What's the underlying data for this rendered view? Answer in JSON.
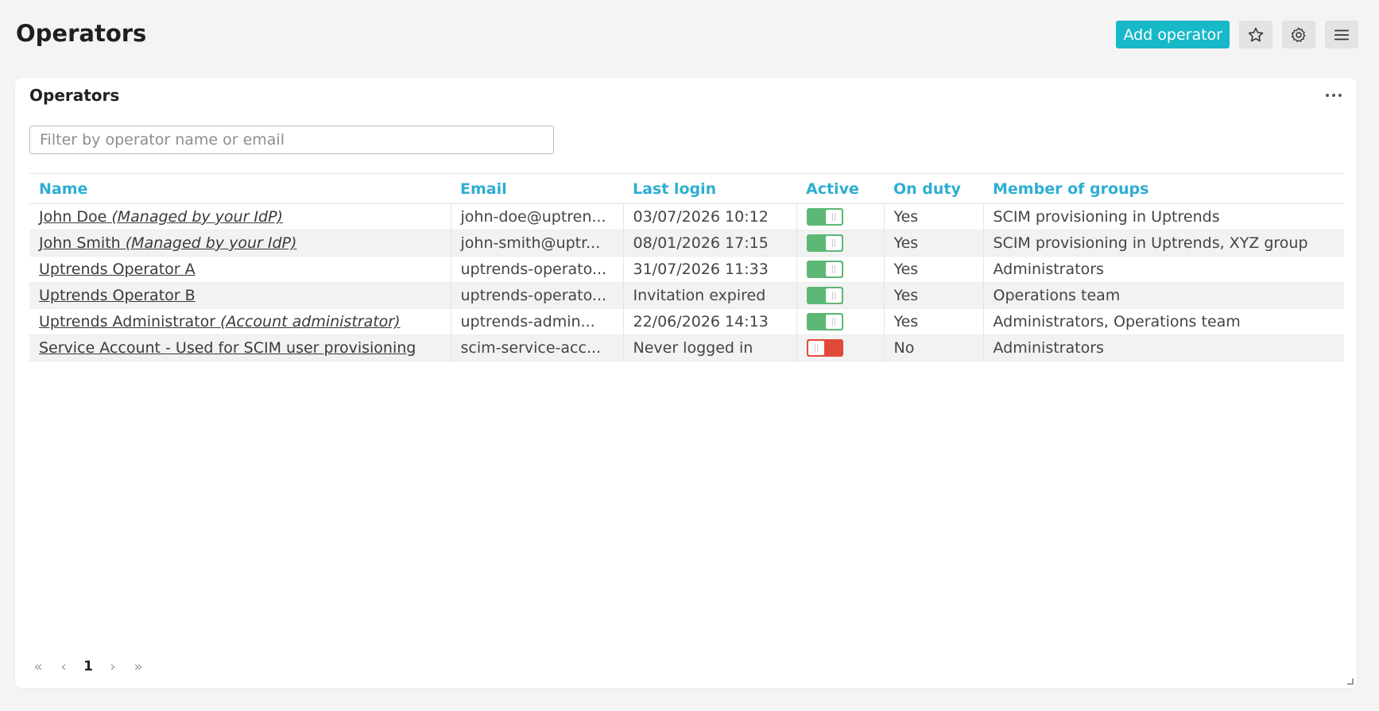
{
  "header": {
    "title": "Operators",
    "add_label": "Add operator"
  },
  "icons": {
    "favorite": "star-outline-icon",
    "settings": "gear-icon",
    "menu": "hamburger-menu-icon",
    "card_menu": "ellipsis-icon"
  },
  "colors": {
    "accent": "#17b8c8",
    "header_text": "#2eaed2",
    "toggle_on": "#5cb874",
    "toggle_off": "#e04a3b"
  },
  "card": {
    "title": "Operators",
    "filter_placeholder": "Filter by operator name or email"
  },
  "table": {
    "columns": [
      "Name",
      "Email",
      "Last login",
      "Active",
      "On duty",
      "Member of groups"
    ],
    "rows": [
      {
        "name": "John Doe",
        "name_note": "(Managed by your IdP)",
        "email": "john-doe@uptren...",
        "last_login": "03/07/2026 10:12",
        "active": true,
        "on_duty": "Yes",
        "groups": "SCIM provisioning in Uptrends"
      },
      {
        "name": "John Smith",
        "name_note": "(Managed by your IdP)",
        "email": "john-smith@uptr...",
        "last_login": "08/01/2026 17:15",
        "active": true,
        "on_duty": "Yes",
        "groups": "SCIM provisioning in Uptrends, XYZ group"
      },
      {
        "name": "Uptrends Operator A",
        "name_note": "",
        "email": "uptrends-operato...",
        "last_login": "31/07/2026 11:33",
        "active": true,
        "on_duty": "Yes",
        "groups": "Administrators"
      },
      {
        "name": "Uptrends Operator B",
        "name_note": "",
        "email": "uptrends-operato...",
        "last_login": "Invitation expired",
        "active": true,
        "on_duty": "Yes",
        "groups": "Operations team"
      },
      {
        "name": "Uptrends Administrator",
        "name_note": "(Account administrator)",
        "email": "uptrends-admin...",
        "last_login": "22/06/2026 14:13",
        "active": true,
        "on_duty": "Yes",
        "groups": "Administrators, Operations team"
      },
      {
        "name": "Service Account - Used for SCIM user provisioning",
        "name_note": "",
        "email": "scim-service-acc...",
        "last_login": "Never logged in",
        "active": false,
        "on_duty": "No",
        "groups": "Administrators"
      }
    ]
  },
  "pagination": {
    "first": "«",
    "prev": "‹",
    "current": "1",
    "next": "›",
    "last": "»"
  }
}
